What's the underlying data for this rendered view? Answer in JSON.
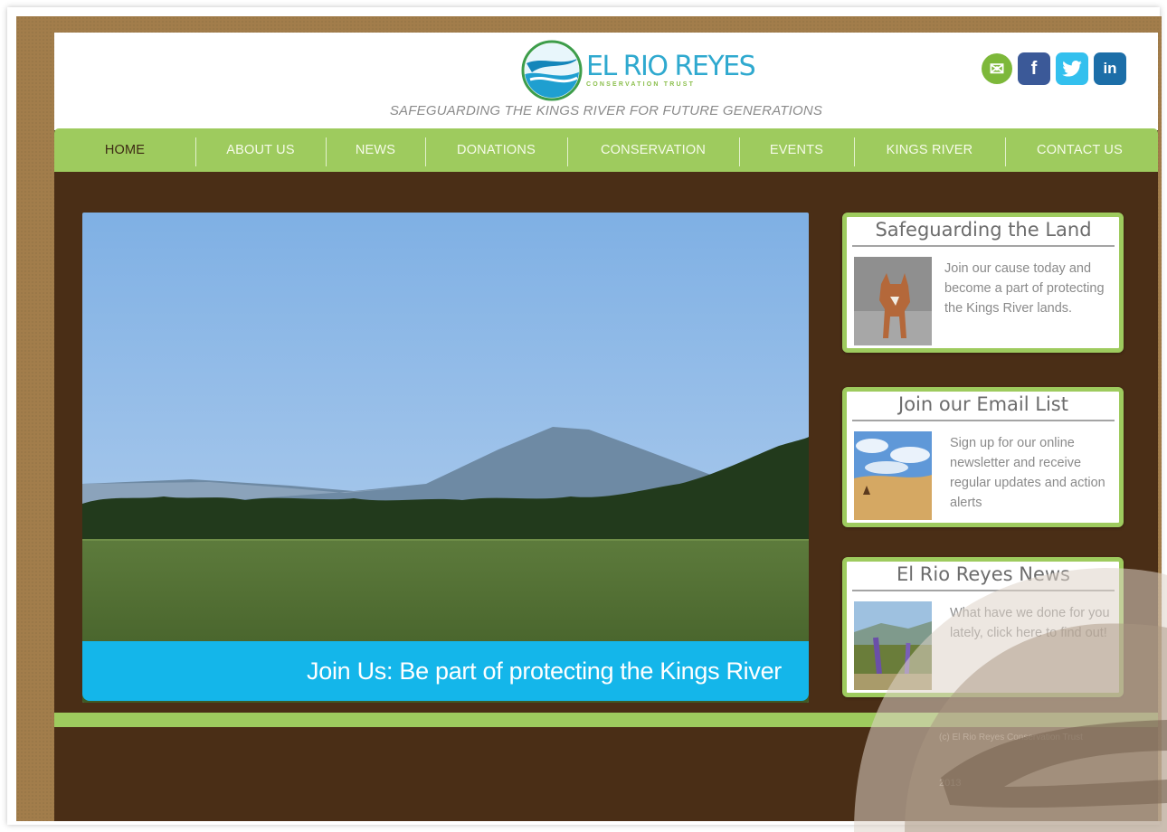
{
  "brand": {
    "name": "EL RIO REYES",
    "subtitle": "CONSERVATION TRUST",
    "tagline": "SAFEGUARDING THE KINGS RIVER FOR FUTURE GENERATIONS"
  },
  "social": [
    {
      "name": "email",
      "glyph": "✉"
    },
    {
      "name": "facebook",
      "glyph": "f"
    },
    {
      "name": "twitter",
      "glyph": "t"
    },
    {
      "name": "linkedin",
      "glyph": "in"
    }
  ],
  "nav": {
    "items": [
      {
        "label": "HOME",
        "active": true
      },
      {
        "label": "ABOUT US",
        "active": false
      },
      {
        "label": "NEWS",
        "active": false
      },
      {
        "label": "DONATIONS",
        "active": false
      },
      {
        "label": "CONSERVATION",
        "active": false
      },
      {
        "label": "EVENTS",
        "active": false
      },
      {
        "label": "KINGS RIVER",
        "active": false
      },
      {
        "label": "CONTACT US",
        "active": false
      }
    ]
  },
  "hero": {
    "caption": "Join Us: Be part of protecting the Kings River"
  },
  "cards": [
    {
      "title": "Safeguarding the Land",
      "text": "Join our cause today and become a part of protecting the Kings River lands."
    },
    {
      "title": "Join our Email List",
      "text": "Sign up for our online newsletter and receive regular updates and action alerts"
    },
    {
      "title": "El Rio Reyes News",
      "text": "What have we done for you lately, click here to find out!"
    }
  ],
  "footer": {
    "copyright": "(c) El Rio Reyes Conservation Trust",
    "year": "2013"
  },
  "colors": {
    "nav_green": "#9ecb5e",
    "page_brown": "#4a2e16",
    "caption_blue": "#14b6ea",
    "logo_blue": "#2fa9cf"
  }
}
